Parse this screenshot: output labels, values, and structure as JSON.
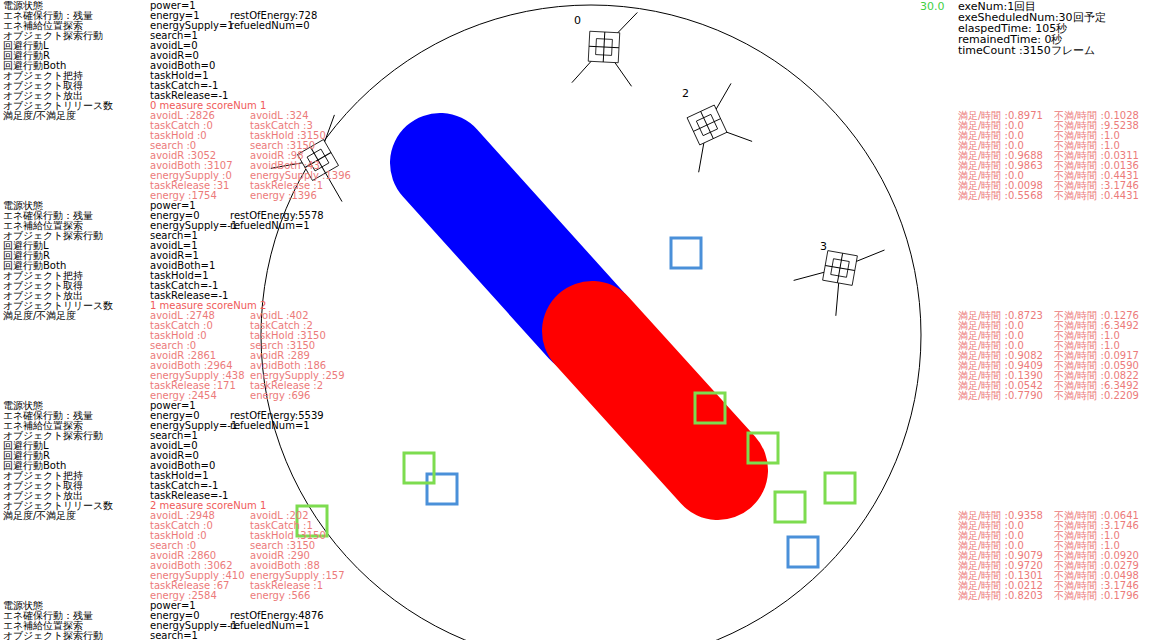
{
  "status": {
    "fps": "30.0",
    "lines": [
      "exeNum:1回目",
      "exeSheduledNum:30回予定",
      "elaspedTime: 105秒",
      "remainedTime: 0秒",
      "timeCount :3150フレーム"
    ]
  },
  "robots": [
    {
      "rows": [
        {
          "label": "電源状態",
          "values": [
            "power=1"
          ]
        },
        {
          "label": "エネ確保行動：残量",
          "values": [
            "energy=1",
            "restOfEnergy:728"
          ]
        },
        {
          "label": "エネ補給位置探索",
          "values": [
            "energySupply=1",
            "refueledNum=0"
          ]
        },
        {
          "label": "オブジェクト探索行動",
          "values": [
            "search=1"
          ]
        },
        {
          "label": "回避行動L",
          "values": [
            "avoidL=0"
          ]
        },
        {
          "label": "回避行動R",
          "values": [
            "avoidR=0"
          ]
        },
        {
          "label": "回避行動Both",
          "values": [
            "avoidBoth=0"
          ]
        },
        {
          "label": "オブジェクト把持",
          "values": [
            "taskHold=1"
          ]
        },
        {
          "label": "オブジェクト取得",
          "values": [
            "taskCatch=-1"
          ]
        },
        {
          "label": "オブジェクト放出",
          "values": [
            "taskRelease=-1"
          ]
        }
      ],
      "release": {
        "label": "オブジェクトリリース数",
        "value": "0 measure scoreNum 1"
      },
      "satisfaction": {
        "label": "満足度/不満足度",
        "pairs": [
          [
            "avoidL :2826",
            "avoidL :324"
          ],
          [
            "taskCatch :0",
            "taskCatch :3"
          ],
          [
            "taskHold :0",
            "taskHold :3150"
          ],
          [
            "search :0",
            "search :3150"
          ],
          [
            "avoidR :3052",
            "avoidR :98"
          ],
          [
            "avoidBoth :3107",
            "avoidBoth :43"
          ],
          [
            "energySupply :0",
            "energySupply :1396"
          ],
          [
            "taskRelease :31",
            "taskRelease :1"
          ],
          [
            "energy :1754",
            "energy :1396"
          ]
        ]
      },
      "ratios": [
        [
          "満足/時間 :0.8971",
          "不満/時間 :0.1028"
        ],
        [
          "満足/時間 :0.0",
          "不満/時間 :9.5238"
        ],
        [
          "満足/時間 :0.0",
          "不満/時間 :1.0"
        ],
        [
          "満足/時間 :0.0",
          "不満/時間 :1.0"
        ],
        [
          "満足/時間 :0.9688",
          "不満/時間 :0.0311"
        ],
        [
          "満足/時間 :0.9863",
          "不満/時間 :0.0136"
        ],
        [
          "満足/時間 :0.0",
          "不満/時間 :0.4431"
        ],
        [
          "満足/時間 :0.0098",
          "不満/時間 :3.1746"
        ],
        [
          "満足/時間 :0.5568",
          "不満/時間 :0.4431"
        ]
      ]
    },
    {
      "rows": [
        {
          "label": "電源状態",
          "values": [
            "power=1"
          ]
        },
        {
          "label": "エネ確保行動：残量",
          "values": [
            "energy=0",
            "restOfEnergy:5578"
          ]
        },
        {
          "label": "エネ補給位置探索",
          "values": [
            "energySupply=-1",
            "refueledNum=1"
          ]
        },
        {
          "label": "オブジェクト探索行動",
          "values": [
            "search=1"
          ]
        },
        {
          "label": "回避行動L",
          "values": [
            "avoidL=1"
          ]
        },
        {
          "label": "回避行動R",
          "values": [
            "avoidR=1"
          ]
        },
        {
          "label": "回避行動Both",
          "values": [
            "avoidBoth=1"
          ]
        },
        {
          "label": "オブジェクト把持",
          "values": [
            "taskHold=1"
          ]
        },
        {
          "label": "オブジェクト取得",
          "values": [
            "taskCatch=-1"
          ]
        },
        {
          "label": "オブジェクト放出",
          "values": [
            "taskRelease=-1"
          ]
        }
      ],
      "release": {
        "label": "オブジェクトリリース数",
        "value": "1 measure scoreNum 2"
      },
      "satisfaction": {
        "label": "満足度/不満足度",
        "pairs": [
          [
            "avoidL :2748",
            "avoidL :402"
          ],
          [
            "taskCatch :0",
            "taskCatch :2"
          ],
          [
            "taskHold :0",
            "taskHold :3150"
          ],
          [
            "search :0",
            "search :3150"
          ],
          [
            "avoidR :2861",
            "avoidR :289"
          ],
          [
            "avoidBoth :2964",
            "avoidBoth :186"
          ],
          [
            "energySupply :438",
            "energySupply :259"
          ],
          [
            "taskRelease :171",
            "taskRelease :2"
          ],
          [
            "energy :2454",
            "energy :696"
          ]
        ]
      },
      "ratios": [
        [
          "満足/時間 :0.8723",
          "不満/時間 :0.1276"
        ],
        [
          "満足/時間 :0.0",
          "不満/時間 :6.3492"
        ],
        [
          "満足/時間 :0.0",
          "不満/時間 :1.0"
        ],
        [
          "満足/時間 :0.0",
          "不満/時間 :1.0"
        ],
        [
          "満足/時間 :0.9082",
          "不満/時間 :0.0917"
        ],
        [
          "満足/時間 :0.9409",
          "不満/時間 :0.0590"
        ],
        [
          "満足/時間 :0.1390",
          "不満/時間 :0.0822"
        ],
        [
          "満足/時間 :0.0542",
          "不満/時間 :6.3492"
        ],
        [
          "満足/時間 :0.7790",
          "不満/時間 :0.2209"
        ]
      ]
    },
    {
      "rows": [
        {
          "label": "電源状態",
          "values": [
            "power=1"
          ]
        },
        {
          "label": "エネ確保行動：残量",
          "values": [
            "energy=0",
            "restOfEnergy:5539"
          ]
        },
        {
          "label": "エネ補給位置探索",
          "values": [
            "energySupply=-1",
            "refueledNum=1"
          ]
        },
        {
          "label": "オブジェクト探索行動",
          "values": [
            "search=1"
          ]
        },
        {
          "label": "回避行動L",
          "values": [
            "avoidL=0"
          ]
        },
        {
          "label": "回避行動R",
          "values": [
            "avoidR=0"
          ]
        },
        {
          "label": "回避行動Both",
          "values": [
            "avoidBoth=0"
          ]
        },
        {
          "label": "オブジェクト把持",
          "values": [
            "taskHold=1"
          ]
        },
        {
          "label": "オブジェクト取得",
          "values": [
            "taskCatch=-1"
          ]
        },
        {
          "label": "オブジェクト放出",
          "values": [
            "taskRelease=-1"
          ]
        }
      ],
      "release": {
        "label": "オブジェクトリリース数",
        "value": "2 measure scoreNum 1"
      },
      "satisfaction": {
        "label": "満足度/不満足度",
        "pairs": [
          [
            "avoidL :2948",
            "avoidL :202"
          ],
          [
            "taskCatch :0",
            "taskCatch :1"
          ],
          [
            "taskHold :0",
            "taskHold :3150"
          ],
          [
            "search :0",
            "search :3150"
          ],
          [
            "avoidR :2860",
            "avoidR :290"
          ],
          [
            "avoidBoth :3062",
            "avoidBoth :88"
          ],
          [
            "energySupply :410",
            "energySupply :157"
          ],
          [
            "taskRelease :67",
            "taskRelease :1"
          ],
          [
            "energy :2584",
            "energy :566"
          ]
        ]
      },
      "ratios": [
        [
          "満足/時間 :0.9358",
          "不満/時間 :0.0641"
        ],
        [
          "満足/時間 :0.0",
          "不満/時間 :3.1746"
        ],
        [
          "満足/時間 :0.0",
          "不満/時間 :1.0"
        ],
        [
          "満足/時間 :0.0",
          "不満/時間 :1.0"
        ],
        [
          "満足/時間 :0.9079",
          "不満/時間 :0.0920"
        ],
        [
          "満足/時間 :0.9720",
          "不満/時間 :0.0279"
        ],
        [
          "満足/時間 :0.1301",
          "不満/時間 :0.0498"
        ],
        [
          "満足/時間 :0.0212",
          "不満/時間 :3.1746"
        ],
        [
          "満足/時間 :0.8203",
          "不満/時間 :0.1796"
        ]
      ]
    },
    {
      "rows": [
        {
          "label": "電源状態",
          "values": [
            "power=1"
          ]
        },
        {
          "label": "エネ確保行動：残量",
          "values": [
            "energy=0",
            "restOfEnergy:4876"
          ]
        },
        {
          "label": "エネ補給位置探索",
          "values": [
            "energySupply=-1",
            "refueledNum=1"
          ]
        },
        {
          "label": "オブジェクト探索行動",
          "values": [
            "search=1"
          ]
        }
      ]
    }
  ],
  "arena": {
    "bar": [
      {
        "color": "#0000ff"
      },
      {
        "color": "#ff0000"
      }
    ],
    "robots": [
      {
        "label": "0"
      },
      {},
      {
        "label": "2"
      },
      {
        "label": "3"
      }
    ],
    "objects": [
      {
        "color": "#4a90d9"
      },
      {
        "color": "#4a90d9"
      },
      {
        "color": "#4a90d9"
      },
      {
        "color": "#7ddc4f"
      },
      {
        "color": "#7ddc4f"
      },
      {
        "color": "#7ddc4f"
      },
      {
        "color": "#7ddc4f"
      },
      {
        "color": "#7ddc4f"
      },
      {
        "color": "#7ddc4f"
      }
    ]
  }
}
